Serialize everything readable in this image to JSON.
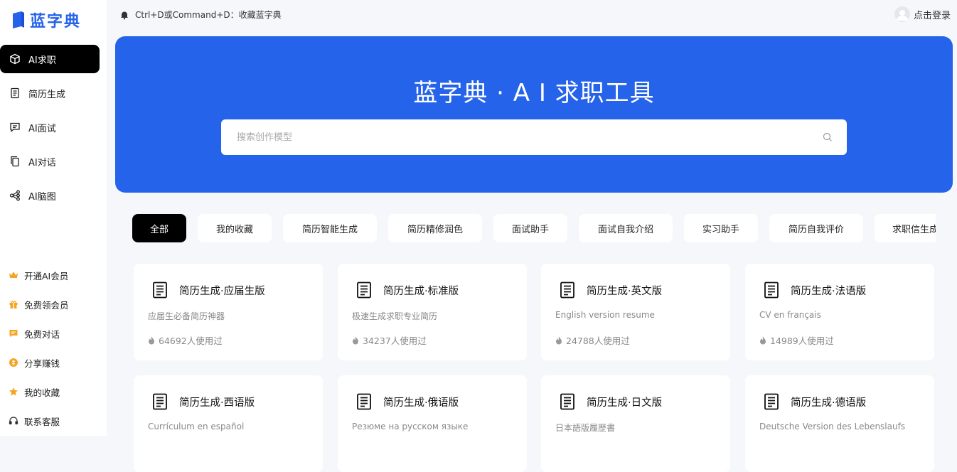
{
  "brand": {
    "name": "蓝字典",
    "color": "#2563eb"
  },
  "sidebar": {
    "nav": [
      {
        "label": "AI求职",
        "icon": "cube-icon",
        "active": true
      },
      {
        "label": "简历生成",
        "icon": "document-icon"
      },
      {
        "label": "AI面试",
        "icon": "message-icon"
      },
      {
        "label": "AI对话",
        "icon": "copy-icon"
      },
      {
        "label": "AI脑图",
        "icon": "mindmap-icon"
      }
    ],
    "bottom": [
      {
        "label": "开通AI会员",
        "icon": "crown-icon"
      },
      {
        "label": "免费领会员",
        "icon": "gift-icon"
      },
      {
        "label": "免费对话",
        "icon": "chat-icon"
      },
      {
        "label": "分享赚钱",
        "icon": "coin-icon"
      },
      {
        "label": "我的收藏",
        "icon": "star-icon"
      },
      {
        "label": "联系客服",
        "icon": "headset-icon"
      }
    ]
  },
  "topbar": {
    "notice": "Ctrl+D或Command+D：收藏蓝字典",
    "login": "点击登录"
  },
  "hero": {
    "title": "蓝字典 · A I 求职工具",
    "search_placeholder": "搜索创作模型"
  },
  "tabs": [
    "全部",
    "我的收藏",
    "简历智能生成",
    "简历精修润色",
    "面试助手",
    "面试自我介绍",
    "实习助手",
    "简历自我评价",
    "求职信生成"
  ],
  "cards": [
    {
      "title": "简历生成·应届生版",
      "desc": "应届生必备简历神器",
      "usage": "64692人使用过"
    },
    {
      "title": "简历生成·标准版",
      "desc": "极速生成求职专业简历",
      "usage": "34237人使用过"
    },
    {
      "title": "简历生成·英文版",
      "desc": "English version resume",
      "usage": "24788人使用过"
    },
    {
      "title": "简历生成·法语版",
      "desc": "CV en français",
      "usage": "14989人使用过"
    },
    {
      "title": "简历生成·西语版",
      "desc": "Currículum en español",
      "usage": ""
    },
    {
      "title": "简历生成·俄语版",
      "desc": "Резюме на русском языке",
      "usage": ""
    },
    {
      "title": "简历生成·日文版",
      "desc": "日本語版履歴書",
      "usage": ""
    },
    {
      "title": "简历生成·德语版",
      "desc": "Deutsche Version des Lebenslaufs",
      "usage": ""
    }
  ]
}
